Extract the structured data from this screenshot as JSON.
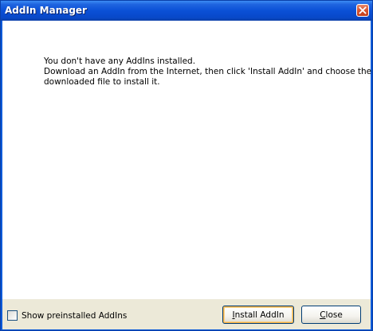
{
  "window": {
    "title": "AddIn Manager"
  },
  "message": {
    "line1": "You don't have any AddIns installed.",
    "line2": "Download an AddIn from the Internet, then click 'Install AddIn' and choose the",
    "line3": "downloaded file to install it."
  },
  "options": {
    "show_preinstalled_label": "Show preinstalled AddIns",
    "show_preinstalled_checked": false
  },
  "buttons": {
    "install_accel": "I",
    "install_rest": "nstall AddIn",
    "close_accel": "C",
    "close_rest": "lose"
  },
  "icons": {
    "close": "close-x-icon"
  },
  "colors": {
    "titlebar": "#0a50d6",
    "close_button": "#d8532f",
    "default_button_highlight": "#f8b346"
  }
}
